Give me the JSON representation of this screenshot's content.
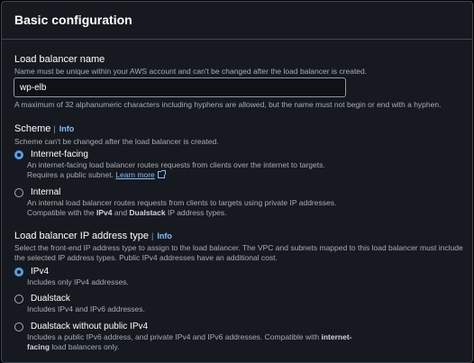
{
  "header": {
    "title": "Basic configuration"
  },
  "lb_name": {
    "label": "Load balancer name",
    "description": "Name must be unique within your AWS account and can't be changed after the load balancer is created.",
    "value": "wp-elb",
    "constraint": "A maximum of 32 alphanumeric characters including hyphens are allowed, but the name must not begin or end with a hyphen."
  },
  "scheme": {
    "label": "Scheme",
    "info": "Info",
    "description": "Scheme can't be changed after the load balancer is created.",
    "options": [
      {
        "title": "Internet-facing",
        "selected": true,
        "desc1": "An internet-facing load balancer routes requests from clients over the internet to targets.",
        "desc2": "Requires a public subnet.",
        "link": "Learn more"
      },
      {
        "title": "Internal",
        "selected": false,
        "desc1": "An internal load balancer routes requests from clients to targets using private IP addresses.",
        "desc2_prefix": "Compatible with the ",
        "desc2_b1": "IPv4",
        "desc2_mid": " and ",
        "desc2_b2": "Dualstack",
        "desc2_suffix": " IP address types."
      }
    ]
  },
  "ip_type": {
    "label": "Load balancer IP address type",
    "info": "Info",
    "description1": "Select the front-end IP address type to assign to the load balancer. The VPC and subnets mapped to this load balancer must include",
    "description2": "the selected IP address types. Public IPv4 addresses have an additional cost.",
    "options": [
      {
        "title": "IPv4",
        "selected": true,
        "desc": "Includes only IPv4 addresses."
      },
      {
        "title": "Dualstack",
        "selected": false,
        "desc": "Includes IPv4 and IPv6 addresses."
      },
      {
        "title": "Dualstack without public IPv4",
        "selected": false,
        "desc1_prefix": "Includes a public IPv6 address, and private IPv4 and IPv6 addresses. Compatible with ",
        "desc1_b": "internet-",
        "desc2_b": "facing",
        "desc2_suffix": " load balancers only."
      }
    ]
  },
  "colors": {
    "accent": "#539fe5",
    "link": "#89bdff",
    "panel": "#16191f"
  }
}
